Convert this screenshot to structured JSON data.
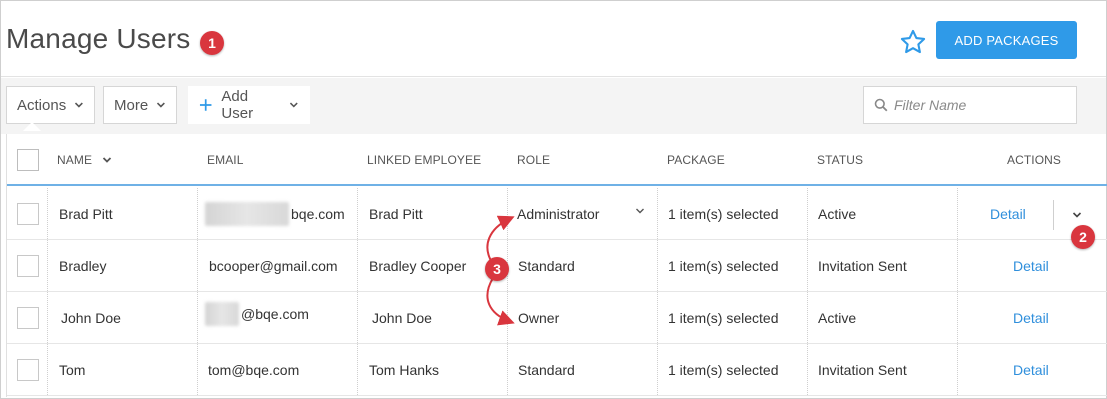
{
  "header": {
    "title": "Manage Users",
    "callout_1": "1",
    "add_packages_label": "ADD PACKAGES",
    "star_icon": "star-outline-icon"
  },
  "toolbar": {
    "actions_label": "Actions",
    "more_label": "More",
    "add_user_label": "Add User",
    "filter_placeholder": "Filter Name"
  },
  "table": {
    "columns": [
      "NAME",
      "EMAIL",
      "LINKED EMPLOYEE",
      "ROLE",
      "PACKAGE",
      "STATUS",
      "ACTIONS"
    ],
    "rows": [
      {
        "name": "Brad Pitt",
        "email_visible": "bqe.com",
        "linked_employee": "Brad Pitt",
        "role": "Administrator",
        "package": "1 item(s) selected",
        "status": "Active",
        "action": "Detail"
      },
      {
        "name": "Bradley",
        "email_visible": "bcooper@gmail.com",
        "linked_employee": "Bradley Cooper",
        "role": "Standard",
        "package": "1 item(s) selected",
        "status": "Invitation Sent",
        "action": "Detail"
      },
      {
        "name": "John Doe",
        "email_visible": "@bqe.com",
        "linked_employee": "John Doe",
        "role": "Owner",
        "package": "1 item(s) selected",
        "status": "Active",
        "action": "Detail"
      },
      {
        "name": "Tom",
        "email_visible": "tom@bqe.com",
        "linked_employee": "Tom Hanks",
        "role": "Standard",
        "package": "1 item(s) selected",
        "status": "Invitation Sent",
        "action": "Detail"
      }
    ]
  },
  "callouts": {
    "two": "2",
    "three": "3"
  },
  "colors": {
    "accent": "#2f9ae8",
    "callout": "#d9363e",
    "link": "#2f8fdc"
  }
}
